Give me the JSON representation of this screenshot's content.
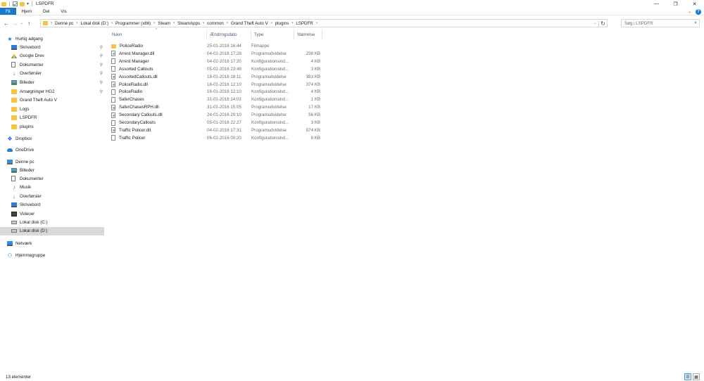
{
  "window": {
    "title": "LSPDFR",
    "minimize": "—",
    "maximize": "❐",
    "close": "✕"
  },
  "ribbon": {
    "tabs": [
      "Fil",
      "Hjem",
      "Del",
      "Vis"
    ]
  },
  "address": {
    "crumbs": [
      "Denne pc",
      "Lokal disk (D:)",
      "Programmer (x86)",
      "Steam",
      "SteamApps",
      "common",
      "Grand Theft Auto V",
      "plugins",
      "LSPDFR"
    ],
    "search_placeholder": "Søg i LSPDFR"
  },
  "nav": {
    "quick_access": "Hurtig adgang",
    "quick_items": [
      {
        "label": "Skrivebord",
        "icon": "desktop-icon",
        "pinned": true
      },
      {
        "label": "Google Drev",
        "icon": "google-drive-icon",
        "pinned": true
      },
      {
        "label": "Dokumenter",
        "icon": "documents-icon",
        "pinned": true
      },
      {
        "label": "Overførsler",
        "icon": "downloads-icon",
        "pinned": true
      },
      {
        "label": "Billeder",
        "icon": "pictures-icon",
        "pinned": true
      },
      {
        "label": "Ansøgninger HG2",
        "icon": "folder-icon",
        "pinned": true
      },
      {
        "label": "Grand Theft Auto V",
        "icon": "folder-icon",
        "pinned": false
      },
      {
        "label": "Logs",
        "icon": "folder-icon",
        "pinned": false
      },
      {
        "label": "LSPDFR",
        "icon": "folder-icon",
        "pinned": false
      },
      {
        "label": "plugins",
        "icon": "folder-icon",
        "pinned": false
      }
    ],
    "dropbox": "Dropbox",
    "onedrive": "OneDrive",
    "this_pc": "Denne pc",
    "pc_items": [
      {
        "label": "Billeder",
        "icon": "pictures-icon"
      },
      {
        "label": "Dokumenter",
        "icon": "documents-icon"
      },
      {
        "label": "Musik",
        "icon": "music-icon"
      },
      {
        "label": "Overførsler",
        "icon": "downloads-icon"
      },
      {
        "label": "Skrivebord",
        "icon": "desktop-icon"
      },
      {
        "label": "Videoer",
        "icon": "videos-icon"
      },
      {
        "label": "Lokal disk (C:)",
        "icon": "disk-icon"
      },
      {
        "label": "Lokal disk (D:)",
        "icon": "disk-icon",
        "selected": true
      }
    ],
    "network": "Netværk",
    "homegroup": "Hjemmegruppe"
  },
  "columns": {
    "name": "Navn",
    "date": "Ændringsdato",
    "type": "Type",
    "size": "Størrelse"
  },
  "files": [
    {
      "name": "PoliceRadio",
      "date": "25-01-2016 16:44",
      "type": "Filmappe",
      "size": "",
      "kind": "folder"
    },
    {
      "name": "Arrest Manager.dll",
      "date": "04-02-2016 17:28",
      "type": "Programudvidelse",
      "size": "238 KB",
      "kind": "dll"
    },
    {
      "name": "Arrest Manager",
      "date": "04-02-2016 17:20",
      "type": "Konfigurationsind...",
      "size": "4 KB",
      "kind": "file"
    },
    {
      "name": "Assorted Callouts",
      "date": "05-02-2016 23:48",
      "type": "Konfigurationsind...",
      "size": "3 KB",
      "kind": "file"
    },
    {
      "name": "AssortedCallouts.dll",
      "date": "18-01-2016 18:11",
      "type": "Programudvidelse",
      "size": "383 KB",
      "kind": "dll"
    },
    {
      "name": "PoliceRadio.dll",
      "date": "18-01-2016 12:10",
      "type": "Programudvidelse",
      "size": "374 KB",
      "kind": "dll"
    },
    {
      "name": "PoliceRadio",
      "date": "18-01-2016 12:10",
      "type": "Konfigurationsind...",
      "size": "4 KB",
      "kind": "file"
    },
    {
      "name": "SaferChases",
      "date": "31-01-2016 14:03",
      "type": "Konfigurationsind...",
      "size": "1 KB",
      "kind": "file"
    },
    {
      "name": "SaferChasesRPH.dll",
      "date": "31-01-2016 15:05",
      "type": "Programudvidelse",
      "size": "17 KB",
      "kind": "dll"
    },
    {
      "name": "Secondary Callouts.dll",
      "date": "24-01-2016 20:10",
      "type": "Programudvidelse",
      "size": "56 KB",
      "kind": "dll"
    },
    {
      "name": "SecondaryCallouts",
      "date": "05-01-2016 22:27",
      "type": "Konfigurationsind...",
      "size": "3 KB",
      "kind": "file"
    },
    {
      "name": "Traffic Policer.dll",
      "date": "04-02-2016 17:31",
      "type": "Programudvidelse",
      "size": "574 KB",
      "kind": "dll"
    },
    {
      "name": "Traffic Policer",
      "date": "06-02-2016 00:20",
      "type": "Konfigurationsind...",
      "size": "8 KB",
      "kind": "file"
    }
  ],
  "status": {
    "count": "13 elementer"
  }
}
